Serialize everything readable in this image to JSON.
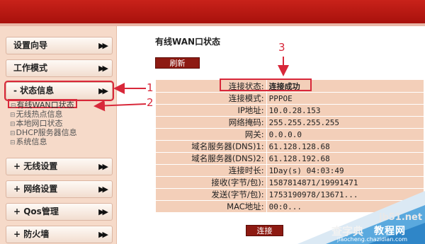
{
  "sidebar": {
    "items": [
      {
        "label": "设置向导",
        "arrow": "▶▶"
      },
      {
        "label": "工作模式",
        "arrow": "▶▶"
      },
      {
        "label": "- 状态信息",
        "arrow": "▶▶"
      },
      {
        "label": "+ 无线设置",
        "arrow": "▶▶"
      },
      {
        "label": "+ 网络设置",
        "arrow": "▶▶"
      },
      {
        "label": "+ Qos管理",
        "arrow": "▶▶"
      },
      {
        "label": "+ 防火墙",
        "arrow": "▶▶"
      }
    ],
    "submenu": [
      {
        "label": "有线WAN口状态"
      },
      {
        "label": "无线热点信息"
      },
      {
        "label": "本地网口状态"
      },
      {
        "label": "DHCP服务器信息"
      },
      {
        "label": "系统信息"
      }
    ]
  },
  "main": {
    "title": "有线WAN口状态",
    "refresh_label": "刷新",
    "connect_label": "连接",
    "rows": [
      {
        "key": "连接状态:",
        "value": "连接成功"
      },
      {
        "key": "连接模式:",
        "value": "PPPOE"
      },
      {
        "key": "IP地址:",
        "value": "10.0.28.153"
      },
      {
        "key": "网络掩码:",
        "value": "255.255.255.255"
      },
      {
        "key": "网关:",
        "value": "0.0.0.0"
      },
      {
        "key": "域名服务器(DNS)1:",
        "value": "61.128.128.68"
      },
      {
        "key": "域名服务器(DNS)2:",
        "value": "61.128.192.68"
      },
      {
        "key": "连接时长:",
        "value": "1Day(s) 04:03:49"
      },
      {
        "key": "接收(字节/包):",
        "value": "1587814871/19991471"
      },
      {
        "key": "发送(字节/包):",
        "value": "1753190978/13671..."
      },
      {
        "key": "MAC地址:",
        "value": "00:0..."
      }
    ]
  },
  "annotations": {
    "n1": "1",
    "n2": "2",
    "n3": "3"
  },
  "watermark": {
    "site": "jb51.net",
    "brand_a": "查字典",
    "brand_b": "教程网",
    "url": "jiaocheng.chazidian.com"
  },
  "colors": {
    "banner": "#b8170f",
    "sidebar_bg": "#f6dac9",
    "table_bg": "#f3cfb9",
    "button": "#8d1a12",
    "annotation": "#d8283a"
  }
}
